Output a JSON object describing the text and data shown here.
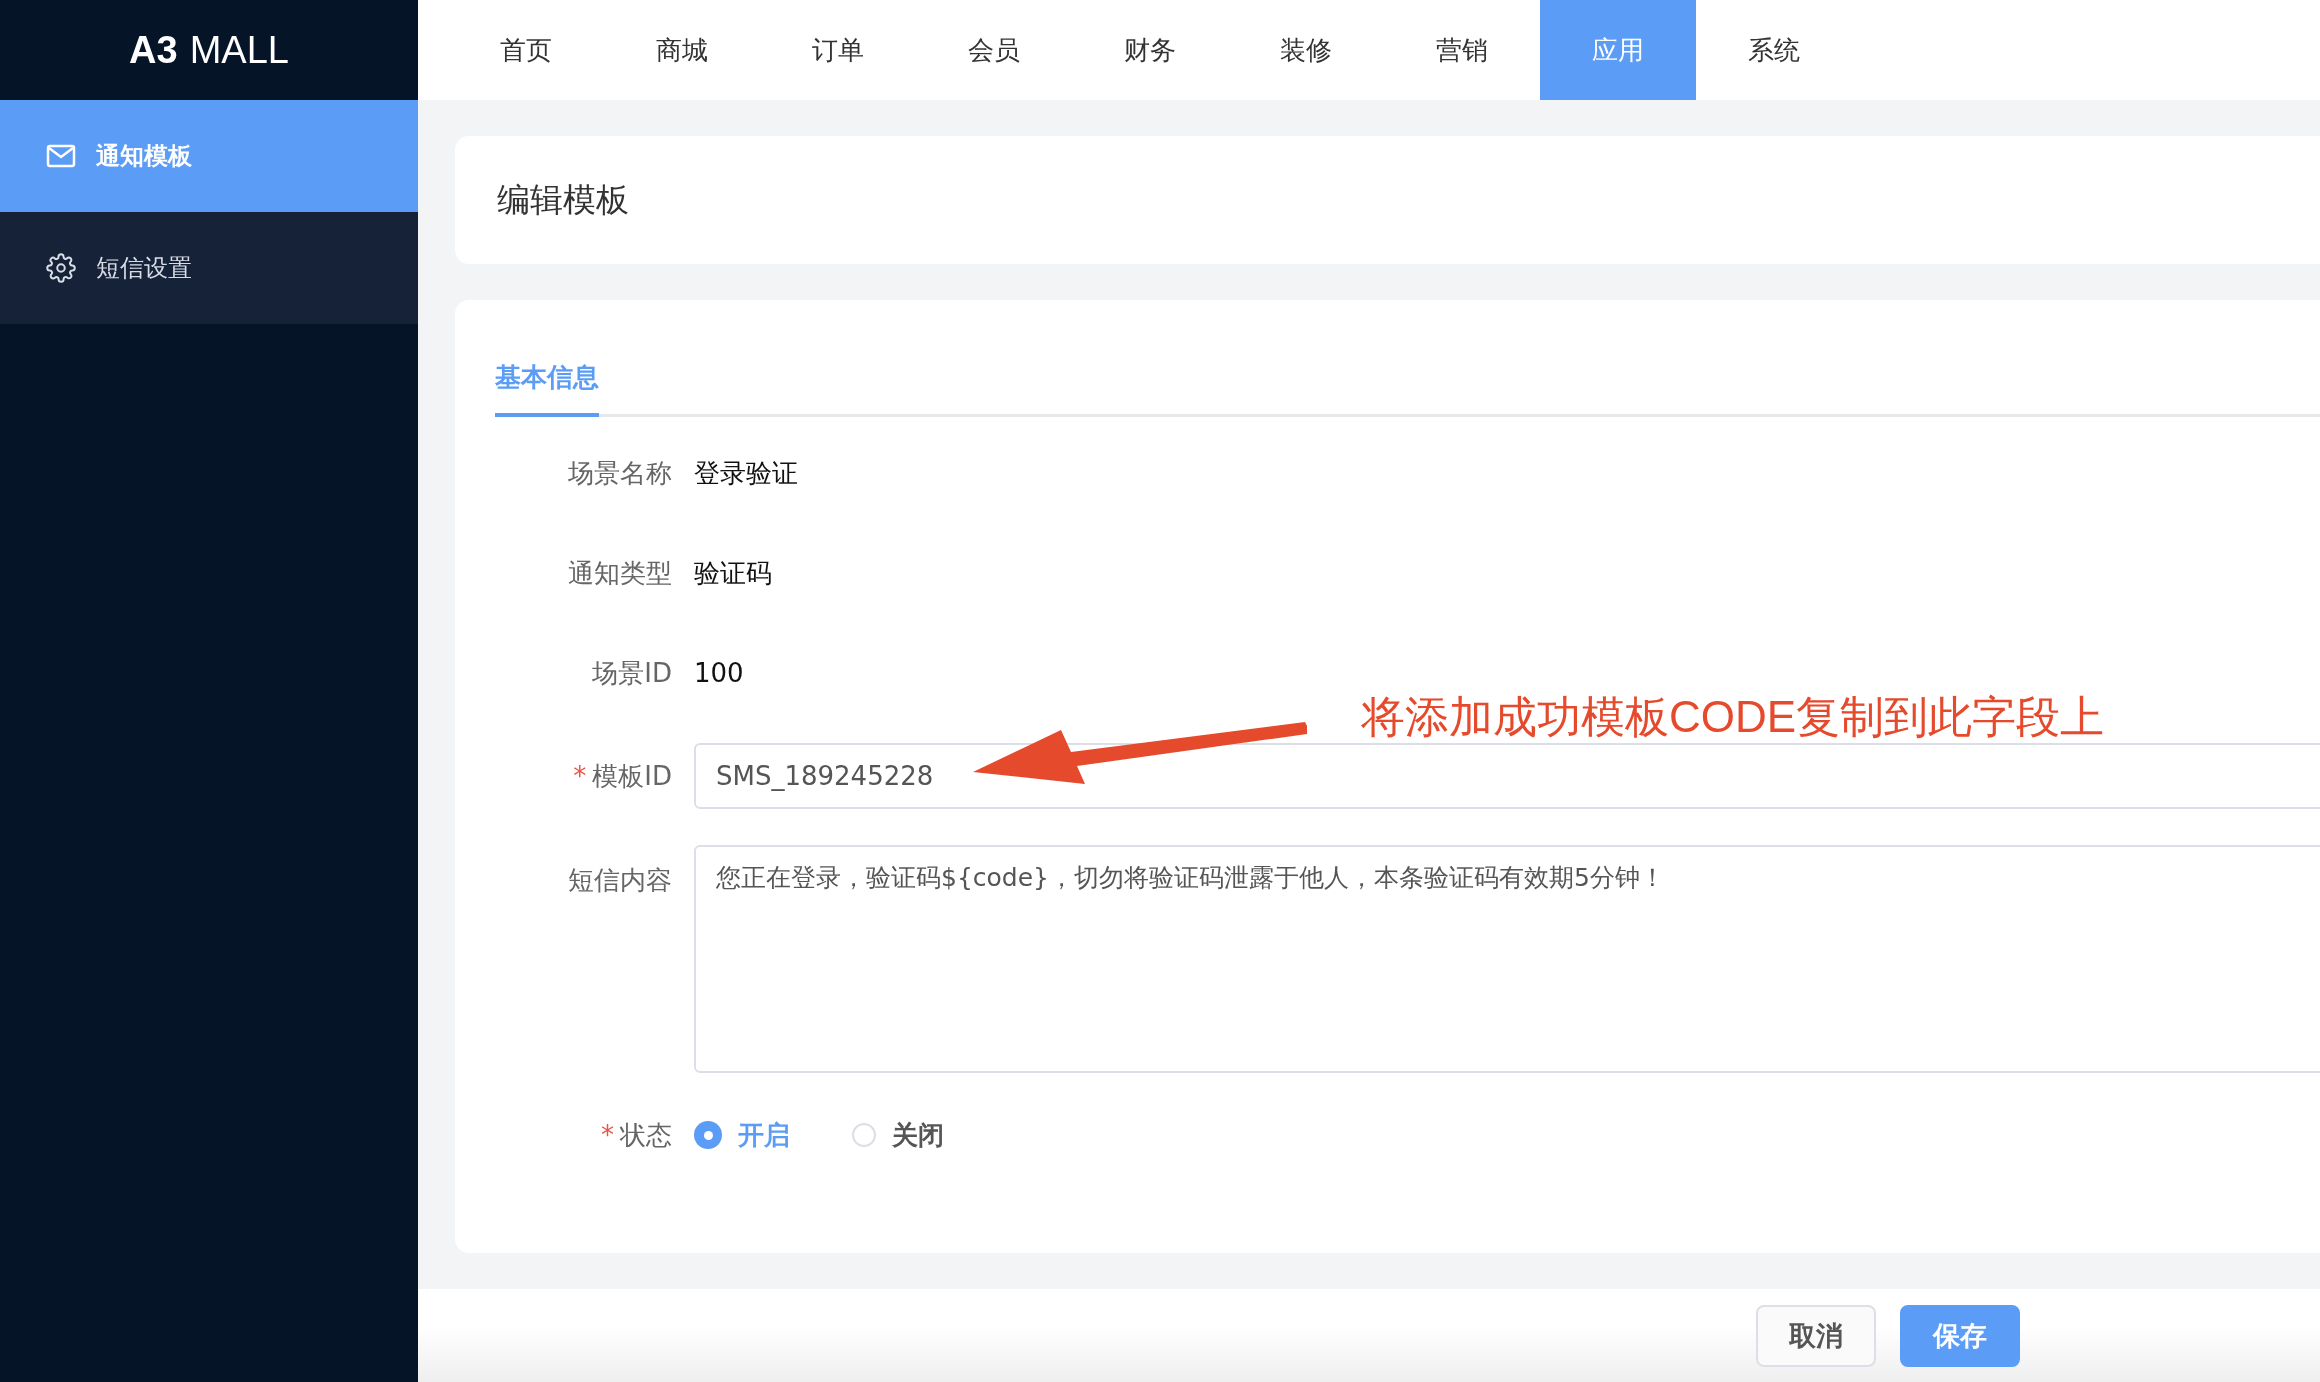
{
  "logo": {
    "bold": "A3",
    "light": "MALL"
  },
  "nav": [
    {
      "label": "首页",
      "selected": false
    },
    {
      "label": "商城",
      "selected": false
    },
    {
      "label": "订单",
      "selected": false
    },
    {
      "label": "会员",
      "selected": false
    },
    {
      "label": "财务",
      "selected": false
    },
    {
      "label": "装修",
      "selected": false
    },
    {
      "label": "营销",
      "selected": false
    },
    {
      "label": "应用",
      "selected": true
    },
    {
      "label": "系统",
      "selected": false
    }
  ],
  "sidebar": {
    "items": [
      {
        "label": "通知模板",
        "selected": true
      },
      {
        "label": "短信设置",
        "selected": false
      }
    ]
  },
  "page_title": "编辑模板",
  "required_mark": "*",
  "tabs": [
    {
      "label": "基本信息",
      "selected": true
    }
  ],
  "form": [
    {
      "kind": "text",
      "label": "场景名称",
      "required": false,
      "value": "登录验证"
    },
    {
      "kind": "text",
      "label": "通知类型",
      "required": false,
      "value": "验证码"
    },
    {
      "kind": "text",
      "label": "场景ID",
      "required": false,
      "value": "100"
    },
    {
      "kind": "input",
      "label": "模板ID",
      "required": true,
      "value": "SMS_189245228"
    },
    {
      "kind": "textarea",
      "label": "短信内容",
      "required": false,
      "value": "您正在登录，验证码${code}，切勿将验证码泄露于他人，本条验证码有效期5分钟！"
    },
    {
      "kind": "radio",
      "label": "状态",
      "required": true,
      "options": [
        {
          "label": "开启",
          "selected": true
        },
        {
          "label": "关闭",
          "selected": false
        }
      ]
    }
  ],
  "annotation": "将添加成功模板CODE复制到此字段上",
  "buttons": [
    {
      "label": "取消",
      "kind": "default"
    },
    {
      "label": "保存",
      "kind": "primary"
    }
  ]
}
